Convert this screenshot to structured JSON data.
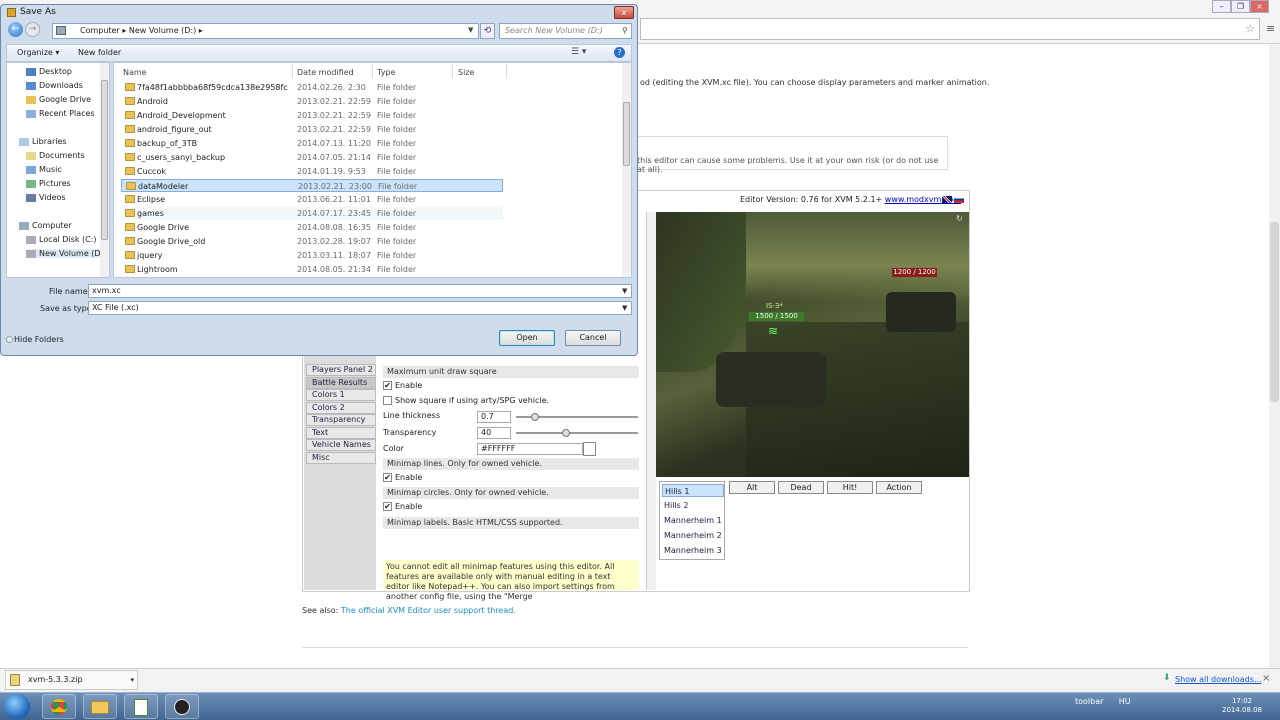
{
  "browser": {
    "menu_icon": "menu-icon",
    "star_icon": "star-icon"
  },
  "page": {
    "intro_text": "od (editing the XVM.xc file). You can choose display parameters and marker animation.",
    "warning_text": "this editor can cause some problems. Use it at your own risk (or do not use at all).",
    "editor_version": "Editor Version: 0.76 for XVM 5.2.1+",
    "site_link": "www.modxvm.com",
    "side_menu": [
      "Players Panel 2",
      "Battle Results",
      "Colors 1",
      "Colors 2",
      "Transparency",
      "Text",
      "Vehicle Names",
      "Misc"
    ],
    "max_square_label": "Maximum unit draw square",
    "enable1": "Enable",
    "show_square_label": "Show square if using arty/SPG vehicle.",
    "line_thickness_label": "Line thickness",
    "line_thickness_value": "0.7",
    "transparency_label": "Transparency",
    "transparency_value": "40",
    "color_label": "Color",
    "color_value": "#FFFFFF",
    "lines_header": "Minimap lines. Only for owned vehicle.",
    "enable2": "Enable",
    "circles_header": "Minimap circles. Only for owned vehicle.",
    "enable3": "Enable",
    "labels_header": "Minimap labels.  Basic HTML/CSS supported.",
    "yellow_note": "You cannot edit all minimap features using this editor. All features are available only with manual editing in a text editor like Notepad++. You can also import settings from another config file, using the \"Merge",
    "preview_label_name": "IS-3*",
    "preview_label_hp": "1500 / 1500",
    "preview_enemy_hp": "1200 / 1200",
    "map_list": [
      "Hills 1",
      "Hills 2",
      "Mannerheim 1",
      "Mannerheim 2",
      "Mannerheim 3"
    ],
    "action_buttons": [
      "Alt",
      "Dead",
      "Hit!",
      "Action"
    ],
    "see_also_prefix": "See also: ",
    "see_also_link": "The official XVM Editor user support thread."
  },
  "download_bar": {
    "file": "xvm-5.3.3.zip",
    "show_all": "Show all downloads...",
    "close": "×"
  },
  "taskbar": {
    "toolbar": "toolbar",
    "lang": "HU",
    "time": "17:02",
    "date": "2014.08.08"
  },
  "dialog": {
    "title": "Save As",
    "close": "x",
    "breadcrumb": "Computer  ▸  New Volume (D:)  ▸",
    "search_placeholder": "Search New Volume (D:)",
    "organize": "Organize ▾",
    "new_folder": "New folder",
    "nav": [
      {
        "label": "Desktop",
        "indent": 1
      },
      {
        "label": "Downloads",
        "indent": 1
      },
      {
        "label": "Google Drive",
        "indent": 1
      },
      {
        "label": "Recent Places",
        "indent": 1
      },
      {
        "label": "Libraries",
        "indent": 0
      },
      {
        "label": "Documents",
        "indent": 1
      },
      {
        "label": "Music",
        "indent": 1
      },
      {
        "label": "Pictures",
        "indent": 1
      },
      {
        "label": "Videos",
        "indent": 1
      },
      {
        "label": "Computer",
        "indent": 0
      },
      {
        "label": "Local Disk (C:)",
        "indent": 1
      },
      {
        "label": "New Volume (D:)",
        "indent": 1
      }
    ],
    "columns": [
      "Name",
      "Date modified",
      "Type",
      "Size"
    ],
    "files": [
      {
        "name": "7fa48f1abbbba68f59cdca138e2958fc",
        "date": "2014.02.26. 2:30",
        "type": "File folder"
      },
      {
        "name": "Android",
        "date": "2013.02.21. 22:59",
        "type": "File folder"
      },
      {
        "name": "Android_Development",
        "date": "2013.02.21. 22:59",
        "type": "File folder"
      },
      {
        "name": "android_figure_out",
        "date": "2013.02.21. 22:59",
        "type": "File folder"
      },
      {
        "name": "backup_of_3TB",
        "date": "2014.07.13. 11:20",
        "type": "File folder"
      },
      {
        "name": "c_users_sanyi_backup",
        "date": "2014.07.05. 21:14",
        "type": "File folder"
      },
      {
        "name": "Cuccok",
        "date": "2014.01.19. 9:53",
        "type": "File folder"
      },
      {
        "name": "dataModeler",
        "date": "2013.02.21. 23:00",
        "type": "File folder"
      },
      {
        "name": "Eclipse",
        "date": "2013.06.21. 11:01",
        "type": "File folder"
      },
      {
        "name": "games",
        "date": "2014.07.17. 23:45",
        "type": "File folder"
      },
      {
        "name": "Google Drive",
        "date": "2014.08.08. 16:35",
        "type": "File folder"
      },
      {
        "name": "Google Drive_old",
        "date": "2013.02.28. 19:07",
        "type": "File folder"
      },
      {
        "name": "jquery",
        "date": "2013.03.11. 18:07",
        "type": "File folder"
      },
      {
        "name": "Lightroom",
        "date": "2014.08.05. 21:34",
        "type": "File folder"
      }
    ],
    "file_name_label": "File name:",
    "file_name_value": "xvm.xc",
    "save_type_label": "Save as type:",
    "save_type_value": "XC File (.xc)",
    "hide_folders": "Hide Folders",
    "open": "Open",
    "cancel": "Cancel"
  }
}
